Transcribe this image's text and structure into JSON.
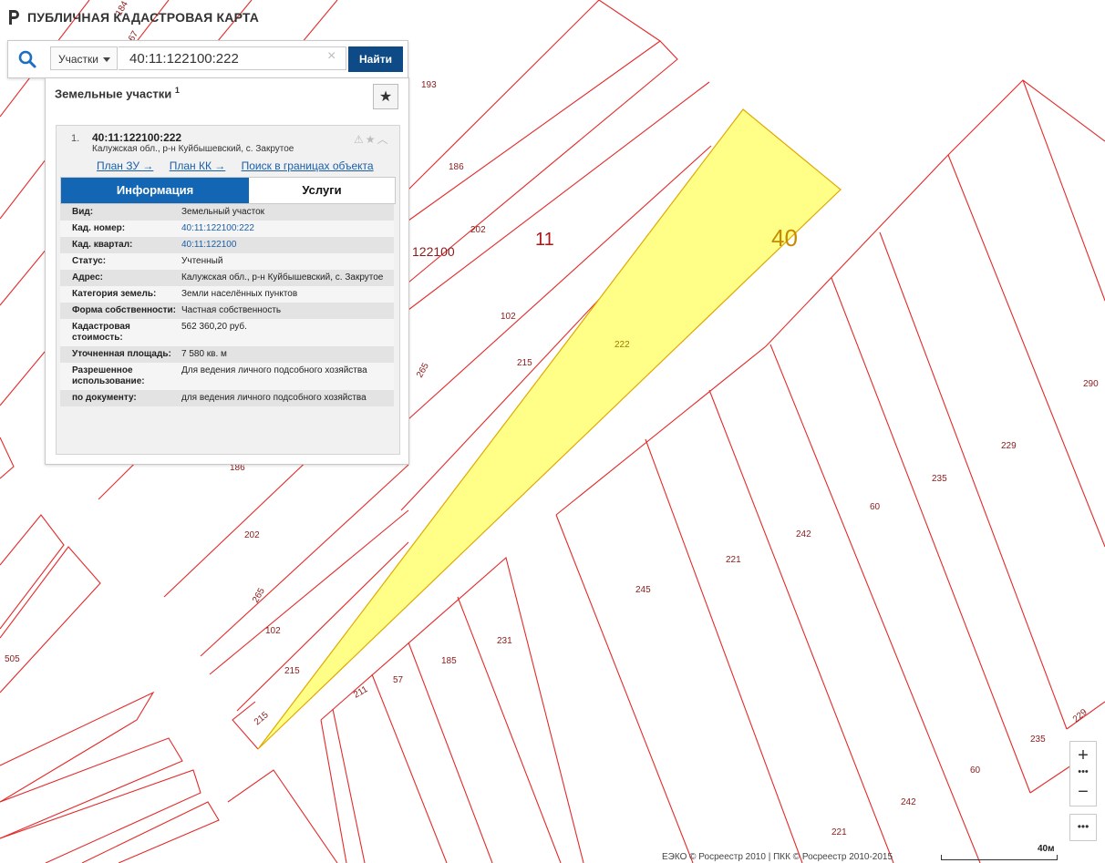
{
  "app": {
    "title": "ПУБЛИЧНАЯ КАДАСТРОВАЯ КАРТА"
  },
  "search": {
    "type_label": "Участки",
    "value": "40:11:122100:222",
    "button": "Найти",
    "clear": "×"
  },
  "panel": {
    "header": "Земельные участки",
    "count": "1",
    "result": {
      "number": "1.",
      "title": "40:11:122100:222",
      "address": "Калужская обл., р-н Куйбышевский, с. Закрутое",
      "links": [
        "План ЗУ →",
        "План КК →",
        "Поиск в границах объекта →"
      ],
      "tabs": [
        "Информация",
        "Услуги"
      ],
      "attributes": [
        {
          "key": "Вид:",
          "value": "Земельный участок",
          "link": false
        },
        {
          "key": "Кад. номер:",
          "value": "40:11:122100:222",
          "link": true
        },
        {
          "key": "Кад. квартал:",
          "value": "40:11:122100",
          "link": true
        },
        {
          "key": "Статус:",
          "value": "Учтенный",
          "link": false
        },
        {
          "key": "Адрес:",
          "value": "Калужская обл., р-н Куйбышевский, с. Закрутое",
          "link": false
        },
        {
          "key": "Категория земель:",
          "value": "Земли населённых пунктов",
          "link": false
        },
        {
          "key": "Форма собственности:",
          "value": "Частная собственность",
          "link": false
        },
        {
          "key": "Кадастровая стоимость:",
          "value": "562 360,20 руб.",
          "link": false
        },
        {
          "key": "Уточненная площадь:",
          "value": "7 580 кв. м",
          "link": false
        },
        {
          "key": "Разрешенное использование:",
          "value": "Для ведения личного подсобного хозяйства",
          "link": false
        },
        {
          "key": "по документу:",
          "value": "для ведения личного подсобного хозяйства",
          "link": false
        }
      ]
    }
  },
  "map": {
    "district_label": "11",
    "region_label": "40",
    "quarter_label": "122100",
    "selected_parcel_label": "222",
    "parcel_labels": [
      "193",
      "186",
      "202",
      "102",
      "215",
      "265",
      "186",
      "202",
      "265",
      "102",
      "215",
      "215",
      "211",
      "57",
      "185",
      "231",
      "245",
      "221",
      "242",
      "60",
      "235",
      "229",
      "290",
      "505",
      "235",
      "60",
      "242",
      "221",
      "229",
      "184",
      "67"
    ],
    "colors": {
      "parcel_stroke": "#e32a2a",
      "selected_fill": "#ffff88",
      "selected_stroke": "#e0a800"
    }
  },
  "controls": {
    "zoom_in": "+",
    "zoom_out": "−",
    "more": "•••"
  },
  "footer": {
    "attribution": "ЕЭКО © Росреестр 2010 | ПКК © Росреестр 2010-2015",
    "scale": "40м"
  }
}
